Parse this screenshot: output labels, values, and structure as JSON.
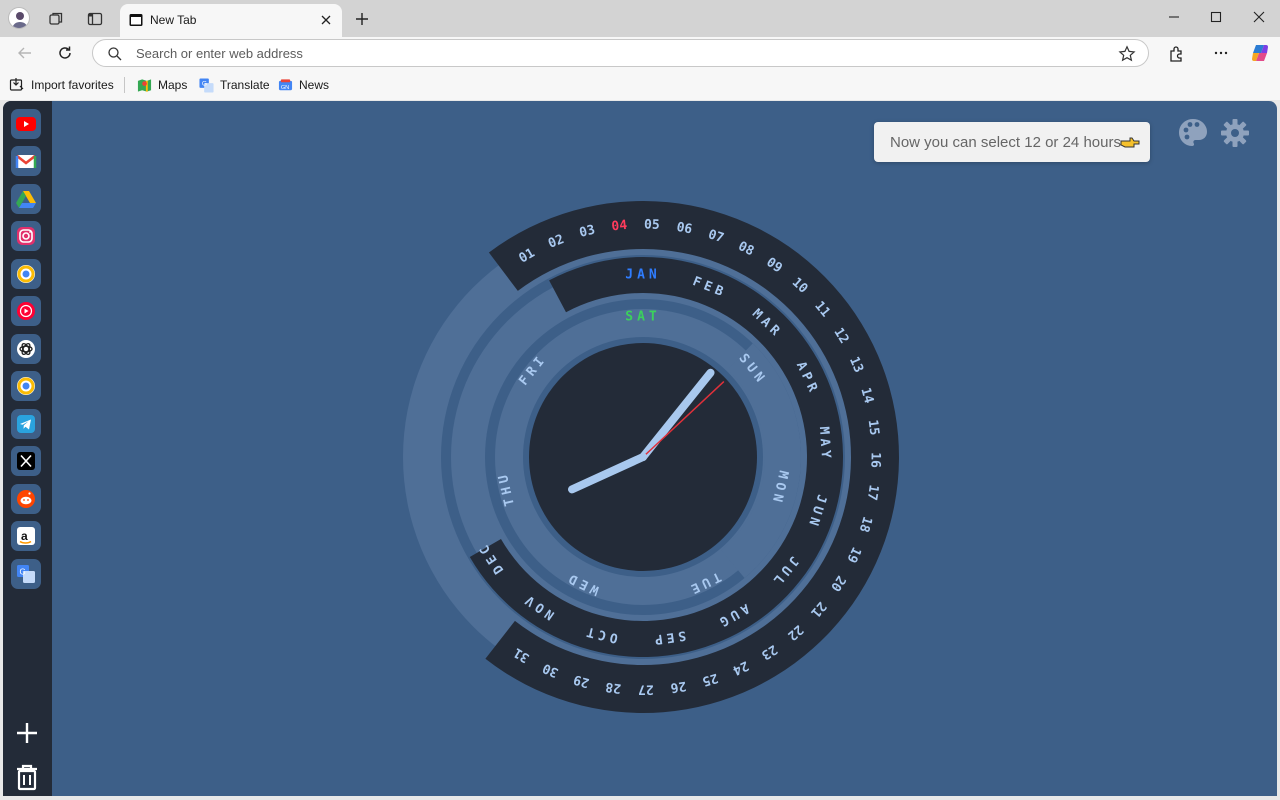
{
  "tab": {
    "title": "New Tab"
  },
  "address_bar": {
    "placeholder": "Search or enter web address"
  },
  "favorites": [
    {
      "label": "Import favorites",
      "icon": "import-favorites-icon"
    },
    {
      "label": "Maps",
      "icon": "maps-icon"
    },
    {
      "label": "Translate",
      "icon": "translate-icon"
    },
    {
      "label": "News",
      "icon": "news-icon"
    }
  ],
  "dock": {
    "apps": [
      "youtube-icon",
      "gmail-icon",
      "google-drive-icon",
      "instagram-icon",
      "chrome-icon",
      "youtube-music-icon",
      "chatgpt-icon",
      "chrome-icon",
      "telegram-icon",
      "x-icon",
      "reddit-icon",
      "amazon-icon",
      "translate-icon"
    ]
  },
  "hint": {
    "text": "Now you can select 12 or 24 hours"
  },
  "clock": {
    "days_of_month": [
      "01",
      "02",
      "03",
      "04",
      "05",
      "06",
      "07",
      "08",
      "09",
      "10",
      "11",
      "12",
      "13",
      "14",
      "15",
      "16",
      "17",
      "18",
      "19",
      "20",
      "21",
      "22",
      "23",
      "24",
      "25",
      "26",
      "27",
      "28",
      "29",
      "30",
      "31"
    ],
    "current_day_of_month": "04",
    "months": [
      "JAN",
      "FEB",
      "MAR",
      "APR",
      "MAY",
      "JUN",
      "JUL",
      "AUG",
      "SEP",
      "OCT",
      "NOV",
      "DEC"
    ],
    "current_month": "JAN",
    "weekdays": [
      "SAT",
      "SUN",
      "MON",
      "TUE",
      "WED",
      "THU",
      "FRI"
    ],
    "current_weekday": "SAT",
    "time": {
      "hour": 8,
      "minute": 5,
      "second": 7
    },
    "colors": {
      "day_highlight": "#ff3b5c",
      "month_highlight": "#2f7dff",
      "weekday_highlight": "#3bd15c",
      "ring_text": "#a9c9f0",
      "hands": "#a8c8ee",
      "second_hand": "#e0303a"
    }
  }
}
